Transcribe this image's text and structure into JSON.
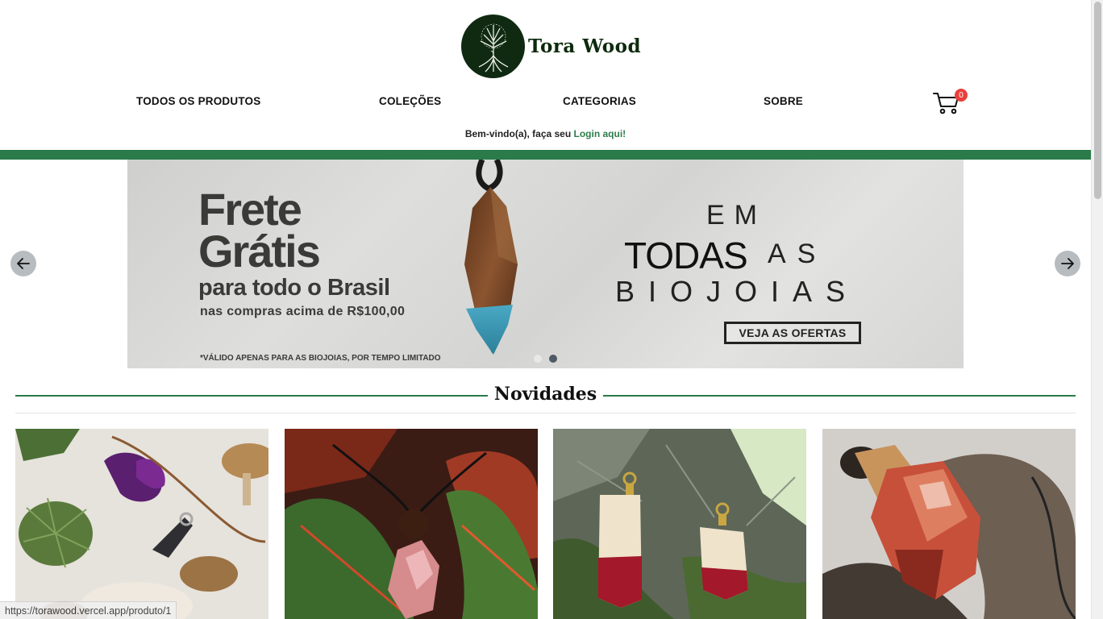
{
  "brand": {
    "name": "Tora Wood"
  },
  "nav": {
    "items": [
      "TODOS OS PRODUTOS",
      "COLEÇÕES",
      "CATEGORIAS",
      "SOBRE"
    ],
    "cart_count": "0"
  },
  "welcome": {
    "text": "Bem-vindo(a), faça seu ",
    "link": "Login aqui!"
  },
  "banner": {
    "line1a": "Frete",
    "line1b": "Grátis",
    "line2": "para todo o Brasil",
    "line3": "nas compras acima de R$100,00",
    "fine": "*VÁLIDO APENAS PARA AS BIOJOIAS, POR TEMPO LIMITADO",
    "em": "EM",
    "todas": "TODAS",
    "as": "AS",
    "biojoias": "BIOJOIAS",
    "cta": "VEJA AS OFERTAS",
    "active_slide": 2,
    "slide_count": 2
  },
  "section": {
    "title": "Novidades"
  },
  "products": [
    {
      "image": "pendant-with-purple-flowers-and-mushrooms"
    },
    {
      "image": "pink-resin-pendant-on-leaves"
    },
    {
      "image": "wood-and-red-resin-earrings-on-tree-bark"
    },
    {
      "image": "red-resin-wood-pendant-on-rock"
    }
  ],
  "status_bar": {
    "url": "https://torawood.vercel.app/produto/1"
  },
  "colors": {
    "accent_green": "#2a7a4a",
    "badge_red": "#e8403b",
    "logo_dark": "#0f2a10"
  }
}
